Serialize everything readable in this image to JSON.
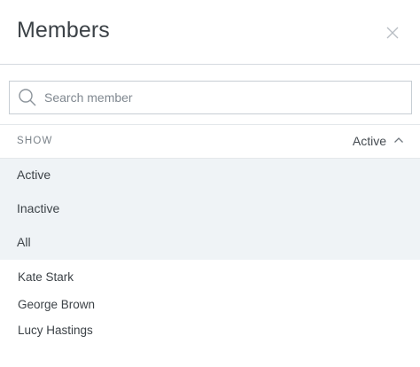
{
  "header": {
    "title": "Members",
    "close_icon": "close-icon"
  },
  "search": {
    "placeholder": "Search member",
    "value": "",
    "icon": "search-icon"
  },
  "filter": {
    "label": "SHOW",
    "selected": "Active",
    "expanded": true,
    "options": [
      "Active",
      "Inactive",
      "All"
    ]
  },
  "members": [
    "Kate Stark",
    "George Brown",
    "Lucy Hastings"
  ],
  "colors": {
    "dropdown_bg": "#eff3f6",
    "text": "#3c4247",
    "muted": "#7a8289",
    "border": "#c7ced4"
  }
}
